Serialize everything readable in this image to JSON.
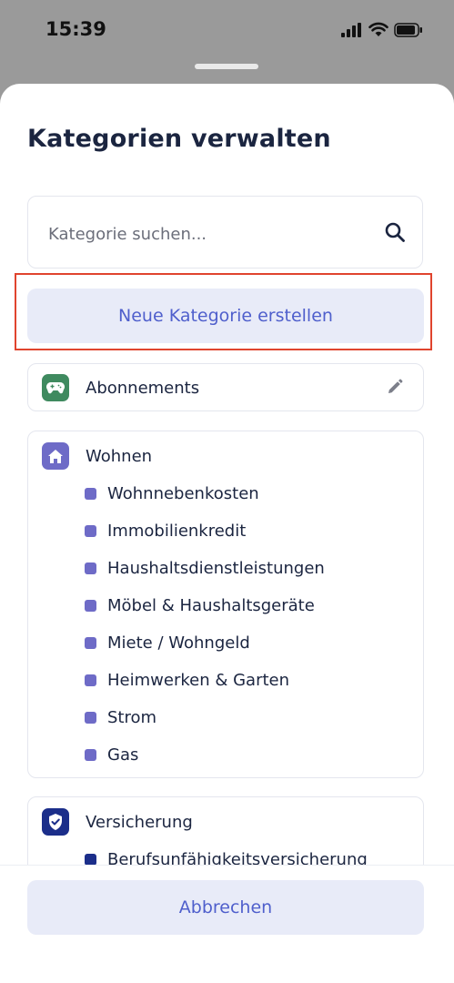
{
  "status": {
    "time": "15:39"
  },
  "sheet": {
    "title": "Kategorien verwalten",
    "search": {
      "placeholder": "Kategorie suchen...",
      "value": ""
    },
    "new_button": "Neue Kategorie erstellen",
    "categories": [
      {
        "label": "Abonnements",
        "icon": "gamepad-icon",
        "color": "#3f8a5f",
        "items": []
      },
      {
        "label": "Wohnen",
        "icon": "home-icon",
        "color": "#6e6bc7",
        "items": [
          "Wohnnebenkosten",
          "Immobilienkredit",
          "Haushaltsdienstleistungen",
          "Möbel & Haushaltsgeräte",
          "Miete / Wohngeld",
          "Heimwerken & Garten",
          "Strom",
          "Gas"
        ]
      },
      {
        "label": "Versicherung",
        "icon": "shield-check-icon",
        "color": "#1b2e8a",
        "items": [
          "Berufsunfähigkeitsversicherung"
        ]
      }
    ],
    "cancel_button": "Abbrechen"
  },
  "colors": {
    "accent": "#4f5fcc",
    "button_bg": "#e8ebf8",
    "highlight": "#e0442e"
  }
}
